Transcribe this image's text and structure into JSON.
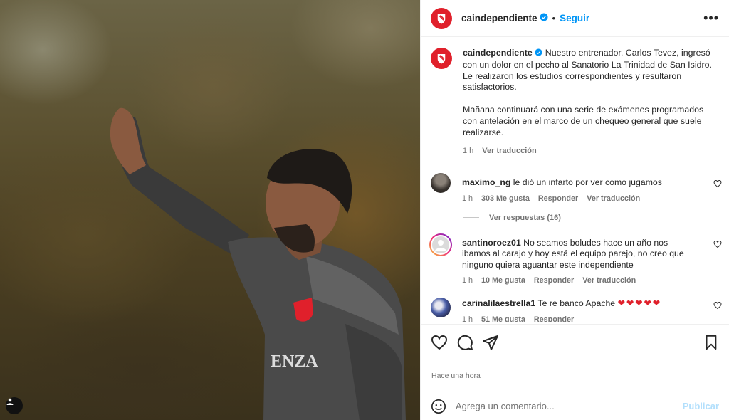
{
  "header": {
    "username": "caindependiente",
    "separator": "•",
    "follow_label": "Seguir",
    "more_label": "•••"
  },
  "caption": {
    "username": "caindependiente",
    "paragraph1": "Nuestro entrenador, Carlos Tevez, ingresó con un dolor en el pecho al Sanatorio La Trinidad de San Isidro. Le realizaron los estudios correspondientes y resultaron satisfactorios.",
    "paragraph2": "Mañana continuará con una serie de exámenes programados con antelación en el marco de un chequeo general que suele realizarse.",
    "time": "1 h",
    "translate_label": "Ver traducción"
  },
  "comments": [
    {
      "username": "maximo_ng",
      "text": "le dió un infarto por ver como jugamos",
      "time": "1 h",
      "likes": "303 Me gusta",
      "reply_label": "Responder",
      "translate_label": "Ver traducción",
      "replies_label": "Ver respuestas (16)"
    },
    {
      "username": "santinoroez01",
      "text": "No seamos boludes hace un año nos ibamos al carajo y hoy está el equipo parejo, no creo que ninguno quiera aguantar este independiente",
      "time": "1 h",
      "likes": "10 Me gusta",
      "reply_label": "Responder",
      "translate_label": "Ver traducción"
    },
    {
      "username": "carinalilaestrella1",
      "text": "Te re banco Apache",
      "hearts": "❤❤❤❤❤",
      "time": "1 h",
      "likes": "51 Me gusta",
      "reply_label": "Responder"
    }
  ],
  "post": {
    "time_ago": "Hace una hora"
  },
  "compose": {
    "placeholder": "Agrega un comentario...",
    "publish_label": "Publicar"
  },
  "colors": {
    "brand_red": "#e0202b",
    "link_blue": "#0095f6",
    "muted": "#737373"
  },
  "icons": [
    "independiente-logo-icon",
    "verified-icon",
    "more-icon",
    "heart-icon",
    "comment-icon",
    "share-icon",
    "bookmark-icon",
    "emoji-icon",
    "user-icon"
  ]
}
